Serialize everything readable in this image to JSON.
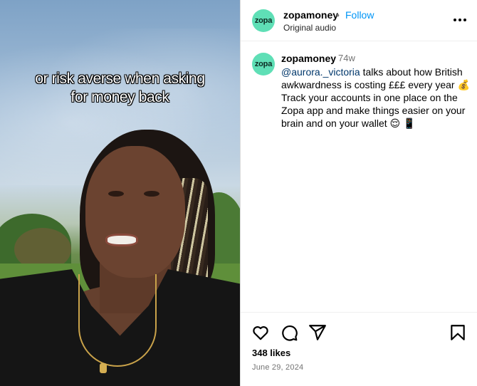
{
  "caption": {
    "line1": "or risk averse when asking",
    "line2": "for money back"
  },
  "header": {
    "avatar_text": "zopa",
    "username": "zopamoney",
    "dot": "•",
    "follow_label": "Follow",
    "audio_label": "Original audio"
  },
  "comment": {
    "avatar_text": "zopa",
    "username": "zopamoney",
    "time": "74w",
    "mention": "@aurora._victoria",
    "text": " talks about how British awkwardness is costing £££ every year 💰 Track your accounts in one place on the Zopa app and make things easier on your brain and on your wallet 😌 📱"
  },
  "footer": {
    "likes": "348 likes",
    "date": "June 29, 2024"
  },
  "colors": {
    "accent": "#0095f6",
    "avatar_bg": "#5fdfb6",
    "mention": "#00376b"
  },
  "icons": [
    "more-icon",
    "heart-icon",
    "comment-icon",
    "share-icon",
    "bookmark-icon"
  ]
}
